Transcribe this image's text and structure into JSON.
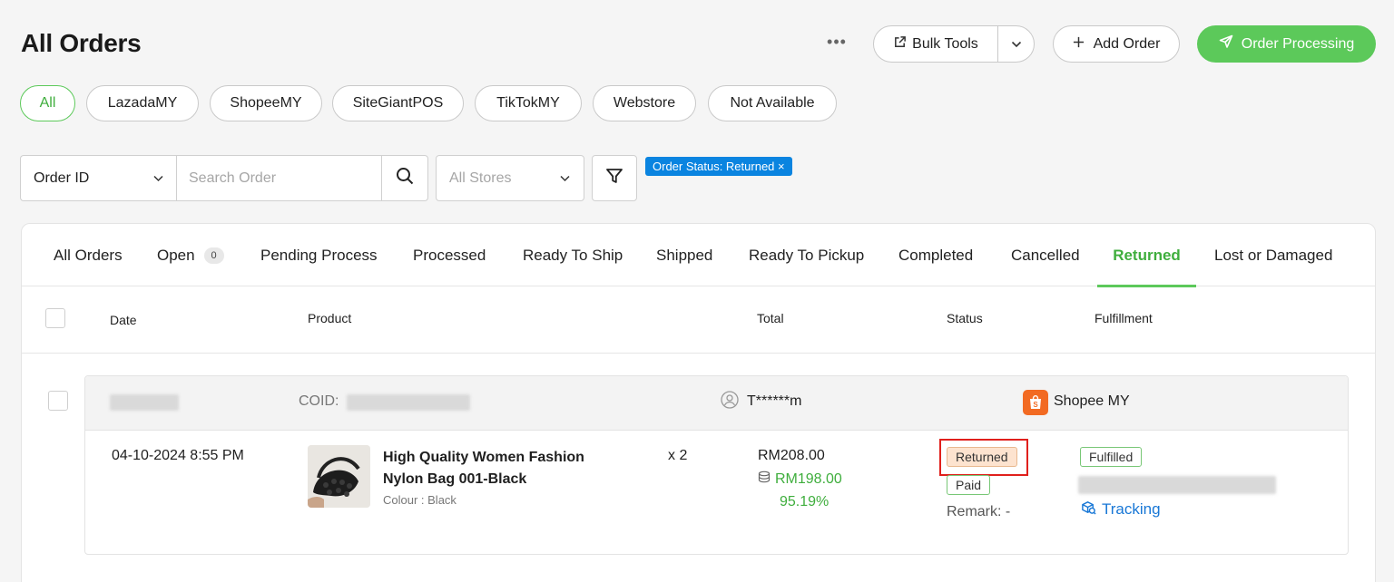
{
  "header": {
    "title": "All Orders",
    "more_label": "•••",
    "bulk_tools_label": "Bulk Tools",
    "add_order_label": "Add Order",
    "order_processing_label": "Order Processing"
  },
  "channels": [
    "All",
    "LazadaMY",
    "ShopeeMY",
    "SiteGiantPOS",
    "TikTokMY",
    "Webstore",
    "Not Available"
  ],
  "search": {
    "field_selected": "Order ID",
    "placeholder": "Search Order",
    "store_selected": "All Stores",
    "active_filter": "Order Status: Returned ×"
  },
  "tabs": [
    {
      "label": "All Orders"
    },
    {
      "label": "Open",
      "count": "0"
    },
    {
      "label": "Pending Process"
    },
    {
      "label": "Processed"
    },
    {
      "label": "Ready To Ship"
    },
    {
      "label": "Shipped"
    },
    {
      "label": "Ready To Pickup"
    },
    {
      "label": "Completed"
    },
    {
      "label": "Cancelled"
    },
    {
      "label": "Returned"
    },
    {
      "label": "Lost or Damaged"
    }
  ],
  "active_tab": "Returned",
  "columns": {
    "date": "Date",
    "product": "Product",
    "total": "Total",
    "status": "Status",
    "fulfillment": "Fulfillment"
  },
  "order": {
    "coid_label": "COID:",
    "customer": "T******m",
    "store": "Shopee MY",
    "date": "04-10-2024 8:55 PM",
    "product_name_line1": "High Quality Women Fashion",
    "product_name_line2": "Nylon Bag 001-Black",
    "variant": "Colour : Black",
    "quantity": "x 2",
    "total": "RM208.00",
    "net": "RM198.00",
    "net_percent": "95.19%",
    "status": "Returned",
    "payment": "Paid",
    "remark": "Remark: -",
    "fulfillment": "Fulfilled",
    "tracking_label": "Tracking"
  },
  "colors": {
    "accent_green": "#5cc95a",
    "link_blue": "#1877d6",
    "filter_tag_blue": "#0a84e0",
    "returned_badge_bg": "#fde3cf",
    "highlight_red": "#e0201c"
  }
}
